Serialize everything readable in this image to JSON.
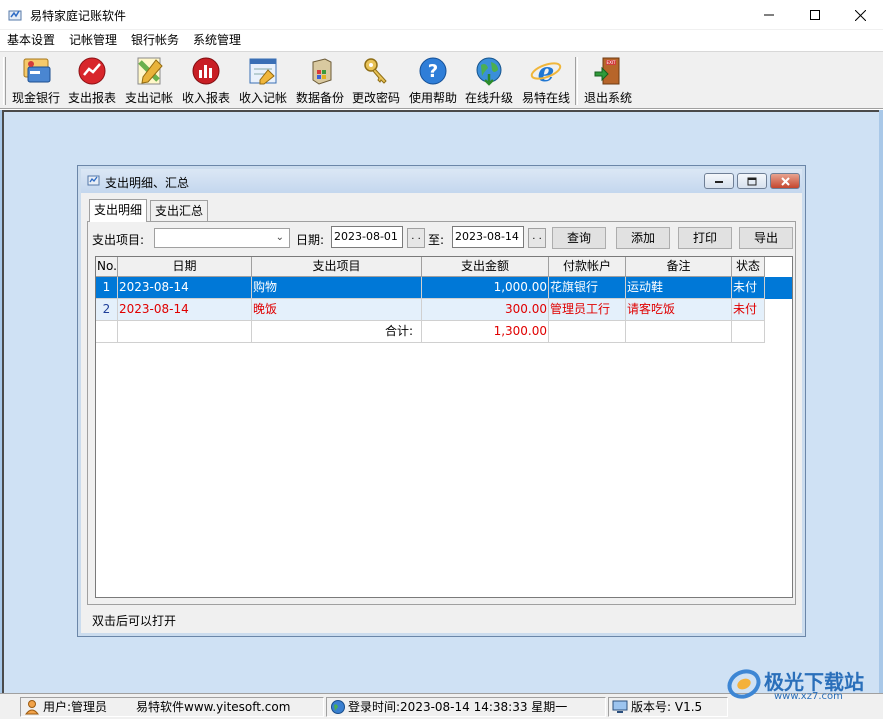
{
  "window": {
    "title": "易特家庭记账软件"
  },
  "menu": [
    "基本设置",
    "记帐管理",
    "银行帐务",
    "系统管理"
  ],
  "toolbar": [
    {
      "label": "现金银行",
      "icon": "cash-bank-icon"
    },
    {
      "label": "支出报表",
      "icon": "expense-report-icon"
    },
    {
      "label": "支出记帐",
      "icon": "expense-entry-icon"
    },
    {
      "label": "收入报表",
      "icon": "income-report-icon"
    },
    {
      "label": "收入记帐",
      "icon": "income-entry-icon"
    },
    {
      "label": "数据备份",
      "icon": "backup-icon"
    },
    {
      "label": "更改密码",
      "icon": "key-icon"
    },
    {
      "label": "使用帮助",
      "icon": "help-icon"
    },
    {
      "label": "在线升级",
      "icon": "globe-icon"
    },
    {
      "label": "易特在线",
      "icon": "ie-icon"
    },
    {
      "label": "退出系统",
      "icon": "exit-icon"
    }
  ],
  "child": {
    "title": "支出明细、汇总",
    "tabs": [
      "支出明细",
      "支出汇总"
    ],
    "filter": {
      "item_label": "支出项目:",
      "item_value": "",
      "date_label": "日期:",
      "date_from": "2023-08-01",
      "to_label": "至:",
      "date_to": "2023-08-14",
      "dd_label": ". .",
      "buttons": {
        "query": "查询",
        "add": "添加",
        "print": "打印",
        "export": "导出"
      }
    },
    "grid": {
      "headers": [
        "No.",
        "日期",
        "支出项目",
        "支出金额",
        "付款帐户",
        "备注",
        "状态"
      ],
      "rows": [
        {
          "no": "1",
          "date": "2023-08-14",
          "item": "购物",
          "amount": "1,000.00",
          "account": "花旗银行",
          "note": "运动鞋",
          "status": "未付"
        },
        {
          "no": "2",
          "date": "2023-08-14",
          "item": "晚饭",
          "amount": "300.00",
          "account": "管理员工行",
          "note": "请客吃饭",
          "status": "未付"
        }
      ],
      "total_label": "合计:",
      "total_amount": "1,300.00"
    },
    "status_text": "双击后可以打开"
  },
  "statusbar": {
    "user": "用户:管理员",
    "company": "易特软件www.yitesoft.com",
    "login": "登录时间:2023-08-14 14:38:33 星期一",
    "version": "版本号: V1.5"
  },
  "watermark": {
    "text": "极光下载站",
    "url": "www.xz7.com"
  },
  "colors": {
    "selection": "#0078d7",
    "alt_row": "#e4f0fb",
    "red_text": "#e00000",
    "mdi_bg": "#cfe1f4"
  }
}
